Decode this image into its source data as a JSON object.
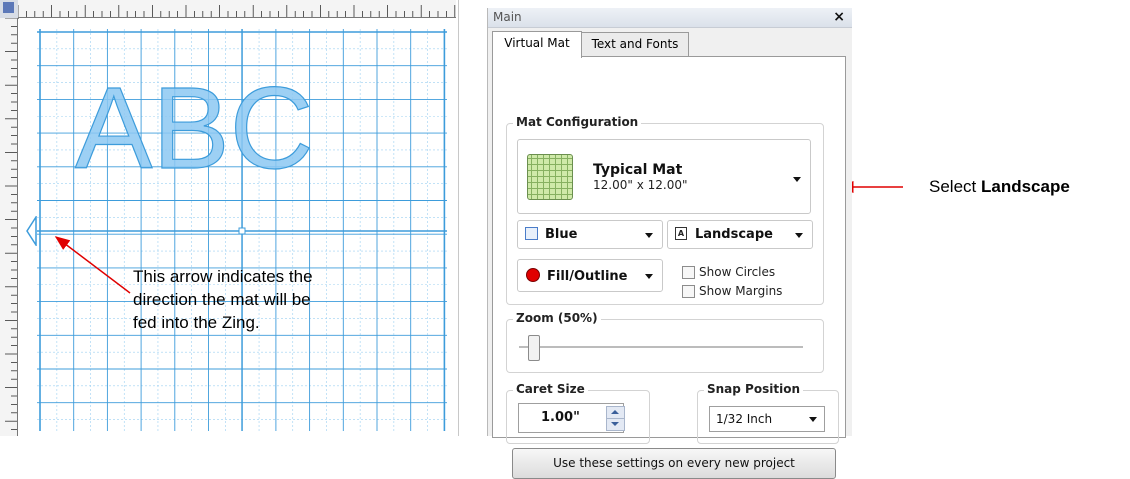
{
  "canvas": {
    "mat_text": "ABC",
    "note_lines": [
      "This arrow indicates the",
      "direction the mat will be",
      "fed into the Zing."
    ]
  },
  "panel": {
    "title": "Main",
    "close_label": "×",
    "tabs": [
      {
        "label": "Virtual Mat",
        "active": true
      },
      {
        "label": "Text and Fonts",
        "active": false
      }
    ],
    "mat_configuration": {
      "title": "Mat Configuration",
      "mat_name": "Typical Mat",
      "mat_size": "12.00\" x 12.00\"",
      "color_label": "Blue",
      "orientation_icon_glyph": "A",
      "orientation_label": "Landscape",
      "fill_label": "Fill/Outline",
      "show_circles_label": "Show Circles",
      "show_margins_label": "Show Margins",
      "show_circles_checked": false,
      "show_margins_checked": false
    },
    "zoom": {
      "label": "Zoom (50%)",
      "level_fraction": 0.05
    },
    "caret_size": {
      "title": "Caret Size",
      "value": "1.00\""
    },
    "snap_position": {
      "title": "Snap Position",
      "value": "1/32 Inch"
    },
    "use_button_label": "Use these settings on every new project"
  },
  "annotation": {
    "prefix": "Select ",
    "emphasis": "Landscape"
  },
  "colors": {
    "grid_line": "#3d9cdb",
    "grid_fine": "#9cd0f2",
    "mat_letters": "#8cc8f2",
    "annotation_arrow": "#e00000"
  },
  "icons": [
    "chevron-down-icon",
    "square-color-icon",
    "orientation-icon",
    "fill-dot-icon",
    "spin-up-icon",
    "spin-down-icon",
    "close-icon",
    "feed-arrow-icon"
  ]
}
